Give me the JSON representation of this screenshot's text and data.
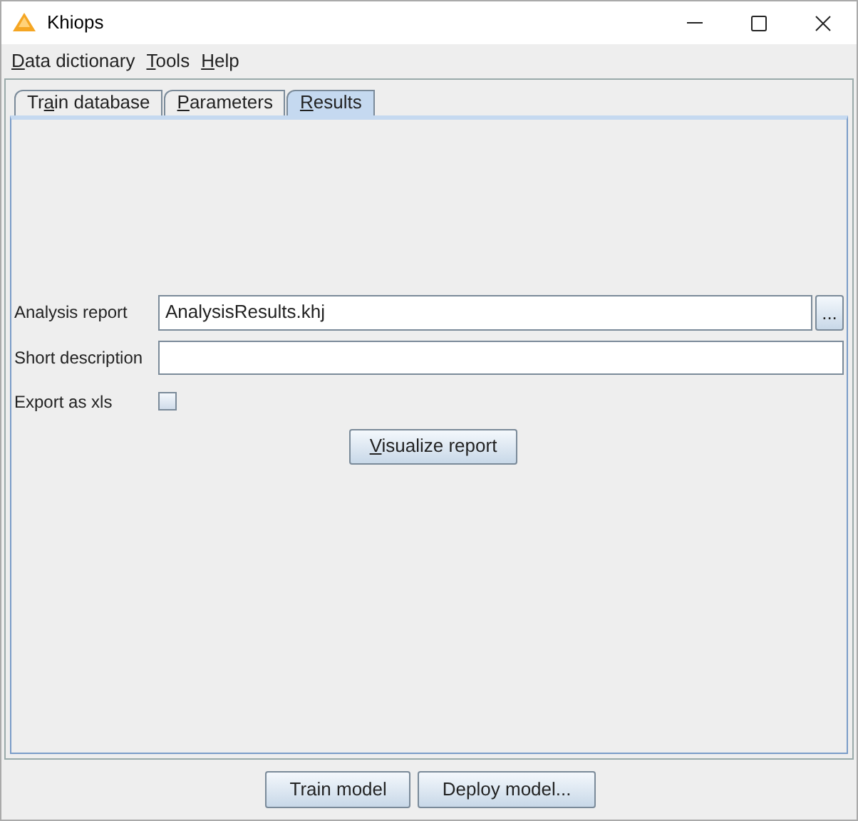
{
  "window": {
    "title": "Khiops"
  },
  "menu": [
    {
      "mnemonic": "D",
      "label_rest": "ata dictionary"
    },
    {
      "mnemonic": "T",
      "label_rest": "ools"
    },
    {
      "mnemonic": "H",
      "label_rest": "elp"
    }
  ],
  "tabs": [
    {
      "label_start": "Tr",
      "mnemonic": "a",
      "label_rest": "in database",
      "selected": false
    },
    {
      "mnemonic": "P",
      "label_rest": "arameters",
      "selected": false
    },
    {
      "mnemonic": "R",
      "label_rest": "esults",
      "selected": true
    }
  ],
  "form": {
    "analysis_report": {
      "label": "Analysis report",
      "value": "AnalysisResults.khj",
      "browse": "..."
    },
    "short_description": {
      "label": "Short description"
    },
    "export_xls": {
      "label": "Export as xls",
      "checked": false
    },
    "visualize": {
      "mnemonic": "V",
      "label_rest": "isualize report"
    }
  },
  "buttons": [
    {
      "label": "Train model"
    },
    {
      "label": "Deploy model..."
    }
  ]
}
